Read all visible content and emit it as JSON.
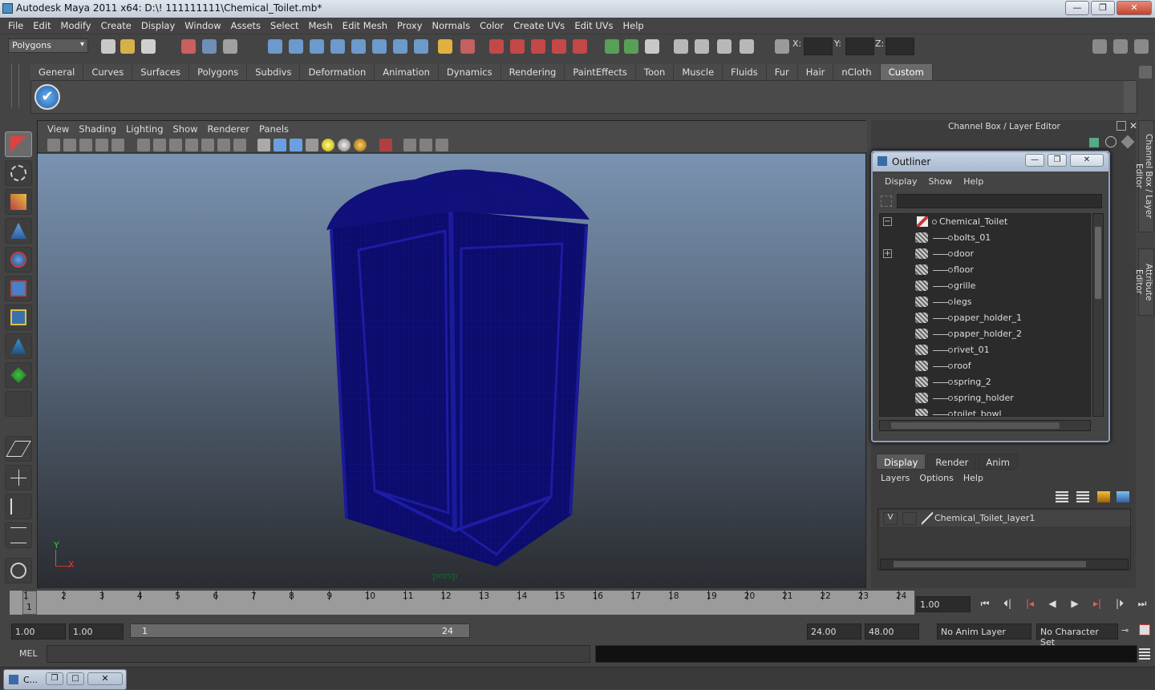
{
  "window": {
    "title": "Autodesk Maya 2011 x64: D:\\! 111111111\\Chemical_Toilet.mb*"
  },
  "menubar": [
    "File",
    "Edit",
    "Modify",
    "Create",
    "Display",
    "Window",
    "Assets",
    "Select",
    "Mesh",
    "Edit Mesh",
    "Proxy",
    "Normals",
    "Color",
    "Create UVs",
    "Edit UVs",
    "Help"
  ],
  "status": {
    "mode": "Polygons",
    "x_label": "X:",
    "y_label": "Y:",
    "z_label": "Z:"
  },
  "shelf_tabs": [
    "General",
    "Curves",
    "Surfaces",
    "Polygons",
    "Subdivs",
    "Deformation",
    "Animation",
    "Dynamics",
    "Rendering",
    "PaintEffects",
    "Toon",
    "Muscle",
    "Fluids",
    "Fur",
    "Hair",
    "nCloth",
    "Custom"
  ],
  "shelf_active": "Custom",
  "viewport": {
    "menu": [
      "View",
      "Shading",
      "Lighting",
      "Show",
      "Renderer",
      "Panels"
    ],
    "camera_label": "persp",
    "axis_y": "Y",
    "axis_x": "X",
    "wire_color": "#0d0d7a"
  },
  "channel_box_title": "Channel Box / Layer Editor",
  "side_tabs": [
    "Channel Box / Layer Editor",
    "Attribute Editor"
  ],
  "outliner": {
    "title": "Outliner",
    "menu": [
      "Display",
      "Show",
      "Help"
    ],
    "root": "Chemical_Toilet",
    "items": [
      "bolts_01",
      "door",
      "floor",
      "grille",
      "legs",
      "paper_holder_1",
      "paper_holder_2",
      "rivet_01",
      "roof",
      "spring_2",
      "spring_holder",
      "toilet_bowl"
    ]
  },
  "layer_editor": {
    "tabs": [
      "Display",
      "Render",
      "Anim"
    ],
    "active_tab": "Display",
    "menu": [
      "Layers",
      "Options",
      "Help"
    ],
    "layer_visible": "V",
    "layer_name": "Chemical_Toilet_layer1"
  },
  "timeline": {
    "ticks": [
      "1",
      "2",
      "3",
      "4",
      "5",
      "6",
      "7",
      "8",
      "9",
      "10",
      "11",
      "12",
      "13",
      "14",
      "15",
      "16",
      "17",
      "18",
      "19",
      "20",
      "21",
      "22",
      "23",
      "24"
    ],
    "current_marker": "1",
    "current_time": "1.00"
  },
  "range": {
    "start_time": "1.00",
    "start_playback": "1.00",
    "slider_start": "1",
    "slider_end": "24",
    "end_playback": "24.00",
    "end_time": "48.00",
    "anim_layer": "No Anim Layer",
    "character_set": "No Character Set"
  },
  "command_line": {
    "label": "MEL"
  },
  "taskbar": {
    "label": "C..."
  }
}
